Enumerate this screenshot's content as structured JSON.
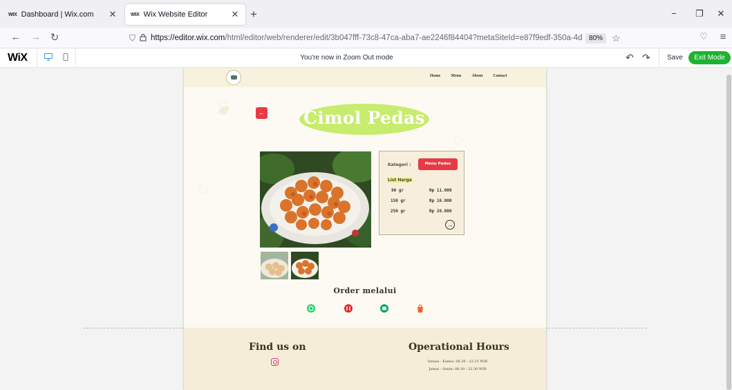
{
  "browser": {
    "tabs": [
      {
        "favicon": "WIX",
        "title": "Dashboard | Wix.com",
        "active": false
      },
      {
        "favicon": "WIX",
        "title": "Wix Website Editor",
        "active": true
      }
    ],
    "url_host": "https://editor.wix.com",
    "url_path": "/html/editor/web/renderer/edit/3b047fff-73c8-47ca-aba7-ae2246f84404?metaSiteId=e87f9edf-350a-4d3d-",
    "zoom": "80%",
    "icons": [
      "back-arrow-icon",
      "forward-arrow-icon",
      "reload-icon",
      "shield-icon",
      "lock-icon",
      "star-icon",
      "pocket-icon",
      "hamburger-menu-icon"
    ]
  },
  "editor": {
    "logo": "WiX",
    "zoom_message": "You're now in Zoom Out mode",
    "save_label": "Save",
    "exit_label": "Exit Mode",
    "accent_color": "#1db232"
  },
  "site": {
    "nav": [
      "Home",
      "Menu",
      "About",
      "Contact"
    ],
    "product_title": "Cimol Pedas",
    "back_icon": "arrow-left-icon",
    "kategori_label": "Kategori  :",
    "kategori_value": "Menu Pedas",
    "price_list_title": "List Harga",
    "prices": [
      {
        "weight": "90 gr",
        "price": "Rp 11.000"
      },
      {
        "weight": "150 gr",
        "price": "Rp 16.000"
      },
      {
        "weight": "250 gr",
        "price": "Rp 26.000"
      }
    ],
    "order_title": "Order melalui",
    "order_channels": [
      "whatsapp-icon",
      "food-delivery-icon",
      "chat-icon",
      "shop-bag-icon"
    ],
    "footer": {
      "find_us": "Find us on",
      "operational_title": "Operational Hours",
      "hours_line1": "Selasa - Kamis: 08.30 - 22.15 WIB",
      "hours_line2": "Jumat - Senin: 08.30 - 22.30 WIB"
    },
    "colors": {
      "title_pill": "#c8ec6e",
      "red_button": "#e63b47",
      "header_bg": "#f8f1de"
    }
  }
}
